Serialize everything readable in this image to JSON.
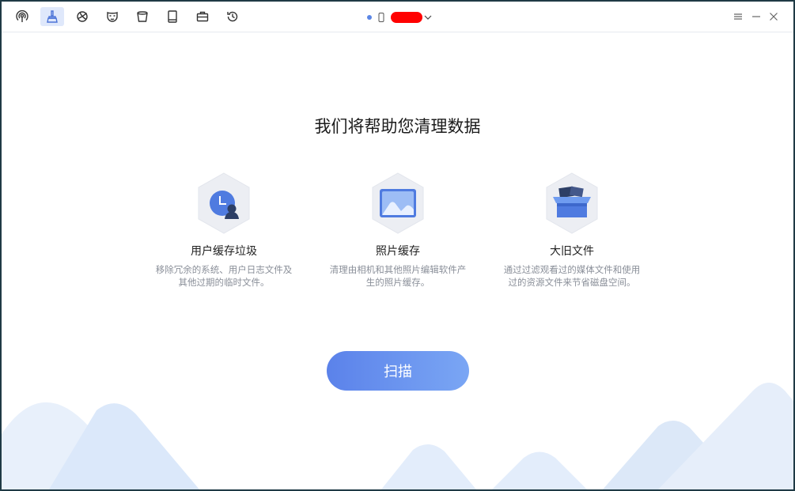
{
  "toolbar": {
    "tools": [
      {
        "icon": "broadcast-icon",
        "active": false
      },
      {
        "icon": "broom-icon",
        "active": true
      },
      {
        "icon": "planet-icon",
        "active": false
      },
      {
        "icon": "mask-icon",
        "active": false
      },
      {
        "icon": "bucket-icon",
        "active": false
      },
      {
        "icon": "book-icon",
        "active": false
      },
      {
        "icon": "briefcase-icon",
        "active": false
      },
      {
        "icon": "history-icon",
        "active": false
      }
    ]
  },
  "device": {
    "name": "",
    "icon": "phone-icon"
  },
  "window_controls": [
    "menu-icon",
    "minimize-icon",
    "close-icon"
  ],
  "main": {
    "title": "我们将帮助您清理数据",
    "features": [
      {
        "title": "用户缓存垃圾",
        "desc": "移除冗余的系统、用户日志文件及其他过期的临时文件。",
        "icon": "user-cache-icon"
      },
      {
        "title": "照片缓存",
        "desc": "清理由相机和其他照片编辑软件产生的照片缓存。",
        "icon": "photo-icon"
      },
      {
        "title": "大旧文件",
        "desc": "通过过滤观看过的媒体文件和使用过的资源文件来节省磁盘空间。",
        "icon": "box-icon"
      }
    ],
    "scan_label": "扫描"
  },
  "colors": {
    "accent": "#5b82ea",
    "accent_light": "#7aa6f4",
    "hex_bg": "#eceef3"
  }
}
